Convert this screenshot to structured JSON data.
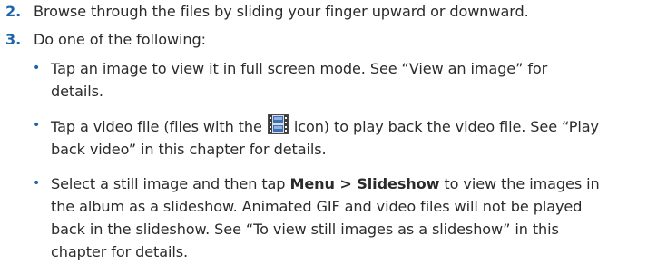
{
  "steps": [
    {
      "number": "2.",
      "text": "Browse through the files by sliding your finger upward or downward."
    },
    {
      "number": "3.",
      "text": "Do one of the following:"
    }
  ],
  "bullets": {
    "marker": "•",
    "b1": {
      "l1": "Tap an image to view it in full screen mode. See “View an image” for",
      "l2": "details."
    },
    "b2": {
      "l1_pre": "Tap a video file (files with the ",
      "l1_post": " icon) to play back the video file. See “Play",
      "l2": "back video” in this chapter for details.",
      "icon": "video-file-icon"
    },
    "b3": {
      "l1_pre": "Select a still image and then tap ",
      "l1_bold": "Menu > Slideshow",
      "l1_post": " to view the images in",
      "l2": "the album as a slideshow. Animated GIF and video files will not be played",
      "l3": "back in the slideshow. See “To view still images as a slideshow” in this",
      "l4": "chapter for details."
    }
  },
  "colors": {
    "accent": "#1f64a8",
    "text": "#2b2b2b"
  }
}
